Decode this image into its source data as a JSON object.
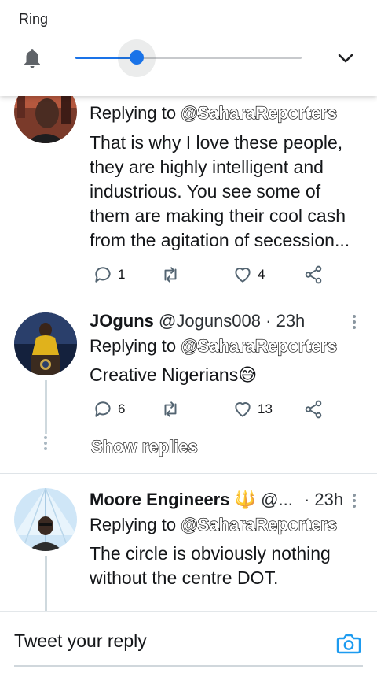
{
  "volume": {
    "title": "Ring",
    "level": 0.27,
    "accent": "#1a73e8",
    "icons": {
      "bell": "bell-icon",
      "collapse": "chevron-down-icon"
    }
  },
  "tweets": [
    {
      "replying_prefix": "Replying to ",
      "replying_to": "@SaharaReporters",
      "lines": [
        "That is why I love these people,",
        "they are highly intelligent and",
        "industrious. You see some of",
        "them are making their cool cash",
        "from the agitation of secession..."
      ],
      "replies": "1",
      "likes": "4"
    },
    {
      "name": "JOguns",
      "handle": "@Joguns008",
      "time": "· 23h",
      "replying_prefix": "Replying to ",
      "replying_to": "@SaharaReporters",
      "text": "Creative Nigerians",
      "emoji": "😅",
      "replies": "6",
      "likes": "13",
      "show_replies": "Show replies"
    },
    {
      "name": "Moore Engineers",
      "badge": "🔱",
      "handle": "@...",
      "time": "· 23h",
      "replying_prefix": "Replying to ",
      "replying_to": "@SaharaReporters",
      "lines": [
        "The circle is obviously nothing",
        "without the centre DOT."
      ]
    }
  ],
  "composer": {
    "placeholder": "Tweet your reply",
    "icon": "camera-icon",
    "accent": "#1d9bf0"
  }
}
